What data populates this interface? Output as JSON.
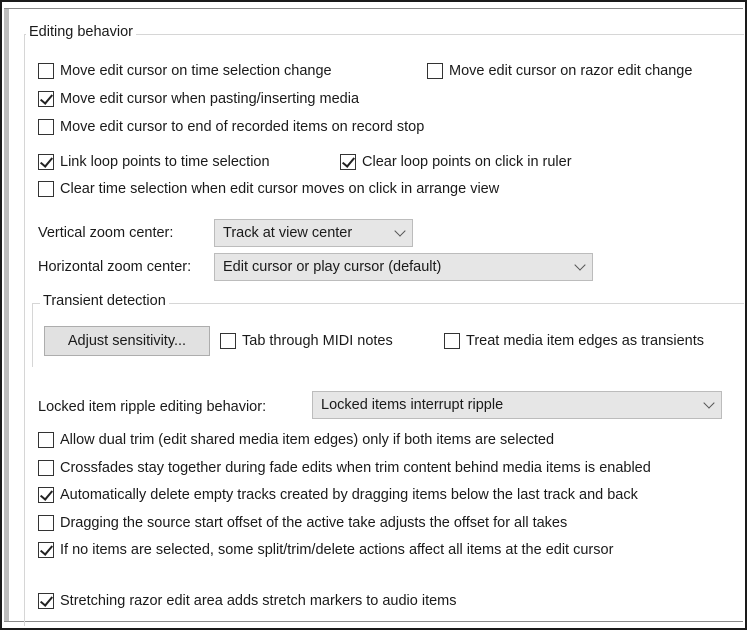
{
  "editing": {
    "title": "Editing behavior",
    "move_on_time_sel": {
      "label": "Move edit cursor on time selection change",
      "checked": false
    },
    "move_on_razor": {
      "label": "Move edit cursor on razor edit change",
      "checked": false
    },
    "move_when_pasting": {
      "label": "Move edit cursor when pasting/inserting media",
      "checked": true
    },
    "move_to_end_recorded": {
      "label": "Move edit cursor to end of recorded items on record stop",
      "checked": false
    },
    "link_loop_points": {
      "label": "Link loop points to time selection",
      "checked": true
    },
    "clear_loop_points": {
      "label": "Clear loop points on click in ruler",
      "checked": true
    },
    "clear_time_selection": {
      "label": "Clear time selection when edit cursor moves on click in arrange view",
      "checked": false
    },
    "vertical_zoom": {
      "label": "Vertical zoom center:",
      "value": "Track at view center"
    },
    "horizontal_zoom": {
      "label": "Horizontal zoom center:",
      "value": "Edit cursor or play cursor (default)"
    },
    "transient": {
      "title": "Transient detection",
      "adjust_button": "Adjust sensitivity...",
      "tab_midi": {
        "label": "Tab through MIDI notes",
        "checked": false
      },
      "treat_edges": {
        "label": "Treat media item edges as transients",
        "checked": false
      }
    },
    "locked_ripple": {
      "label": "Locked item ripple editing behavior:",
      "value": "Locked items interrupt ripple"
    },
    "allow_dual_trim": {
      "label": "Allow dual trim (edit shared media item edges) only if both items are selected",
      "checked": false
    },
    "crossfades_together": {
      "label": "Crossfades stay together during fade edits when trim content behind media items is enabled",
      "checked": false
    },
    "auto_delete_tracks": {
      "label": "Automatically delete empty tracks created by dragging items below the last track and back",
      "checked": true
    },
    "dragging_source_offset": {
      "label": "Dragging the source start offset of the active take adjusts the offset for all takes",
      "checked": false
    },
    "no_items_selected": {
      "label": "If no items are selected, some split/trim/delete actions affect all items at the edit cursor",
      "checked": true
    },
    "stretching_razor": {
      "label": "Stretching razor edit area adds stretch markers to audio items",
      "checked": true
    }
  }
}
